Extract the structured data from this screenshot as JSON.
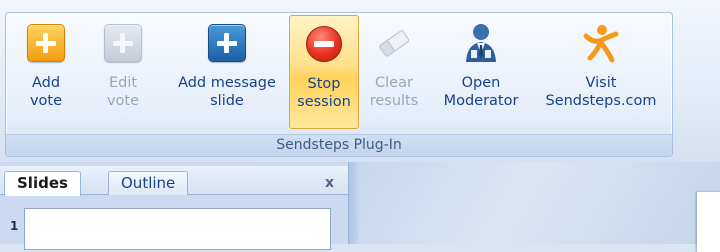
{
  "ribbon": {
    "group_label": "Sendsteps Plug-In",
    "buttons": [
      {
        "id": "add-vote",
        "label_line1": "Add",
        "label_line2": "vote",
        "icon": "orange-plus-icon",
        "state": "enabled"
      },
      {
        "id": "edit-vote",
        "label_line1": "Edit",
        "label_line2": "vote",
        "icon": "grey-plus-icon",
        "state": "disabled"
      },
      {
        "id": "add-message-slide",
        "label_line1": "Add message",
        "label_line2": "slide",
        "icon": "blue-plus-icon",
        "state": "enabled"
      },
      {
        "id": "stop-session",
        "label_line1": "Stop",
        "label_line2": "session",
        "icon": "stop-icon",
        "state": "active"
      },
      {
        "id": "clear-results",
        "label_line1": "Clear",
        "label_line2": "results",
        "icon": "eraser-icon",
        "state": "disabled"
      },
      {
        "id": "open-moderator",
        "label_line1": "Open",
        "label_line2": "Moderator",
        "icon": "moderator-icon",
        "state": "enabled"
      },
      {
        "id": "visit-sendsteps",
        "label_line1": "Visit",
        "label_line2": "Sendsteps.com",
        "icon": "sendsteps-logo-icon",
        "state": "enabled"
      }
    ]
  },
  "pane": {
    "tabs": [
      {
        "label": "Slides",
        "selected": true
      },
      {
        "label": "Outline",
        "selected": false
      }
    ],
    "close_glyph": "x",
    "slide_number": "1"
  },
  "colors": {
    "ribbon_text": "#15428b",
    "disabled_text": "#9aa7b8",
    "active_highlight": "#ffd35a"
  }
}
